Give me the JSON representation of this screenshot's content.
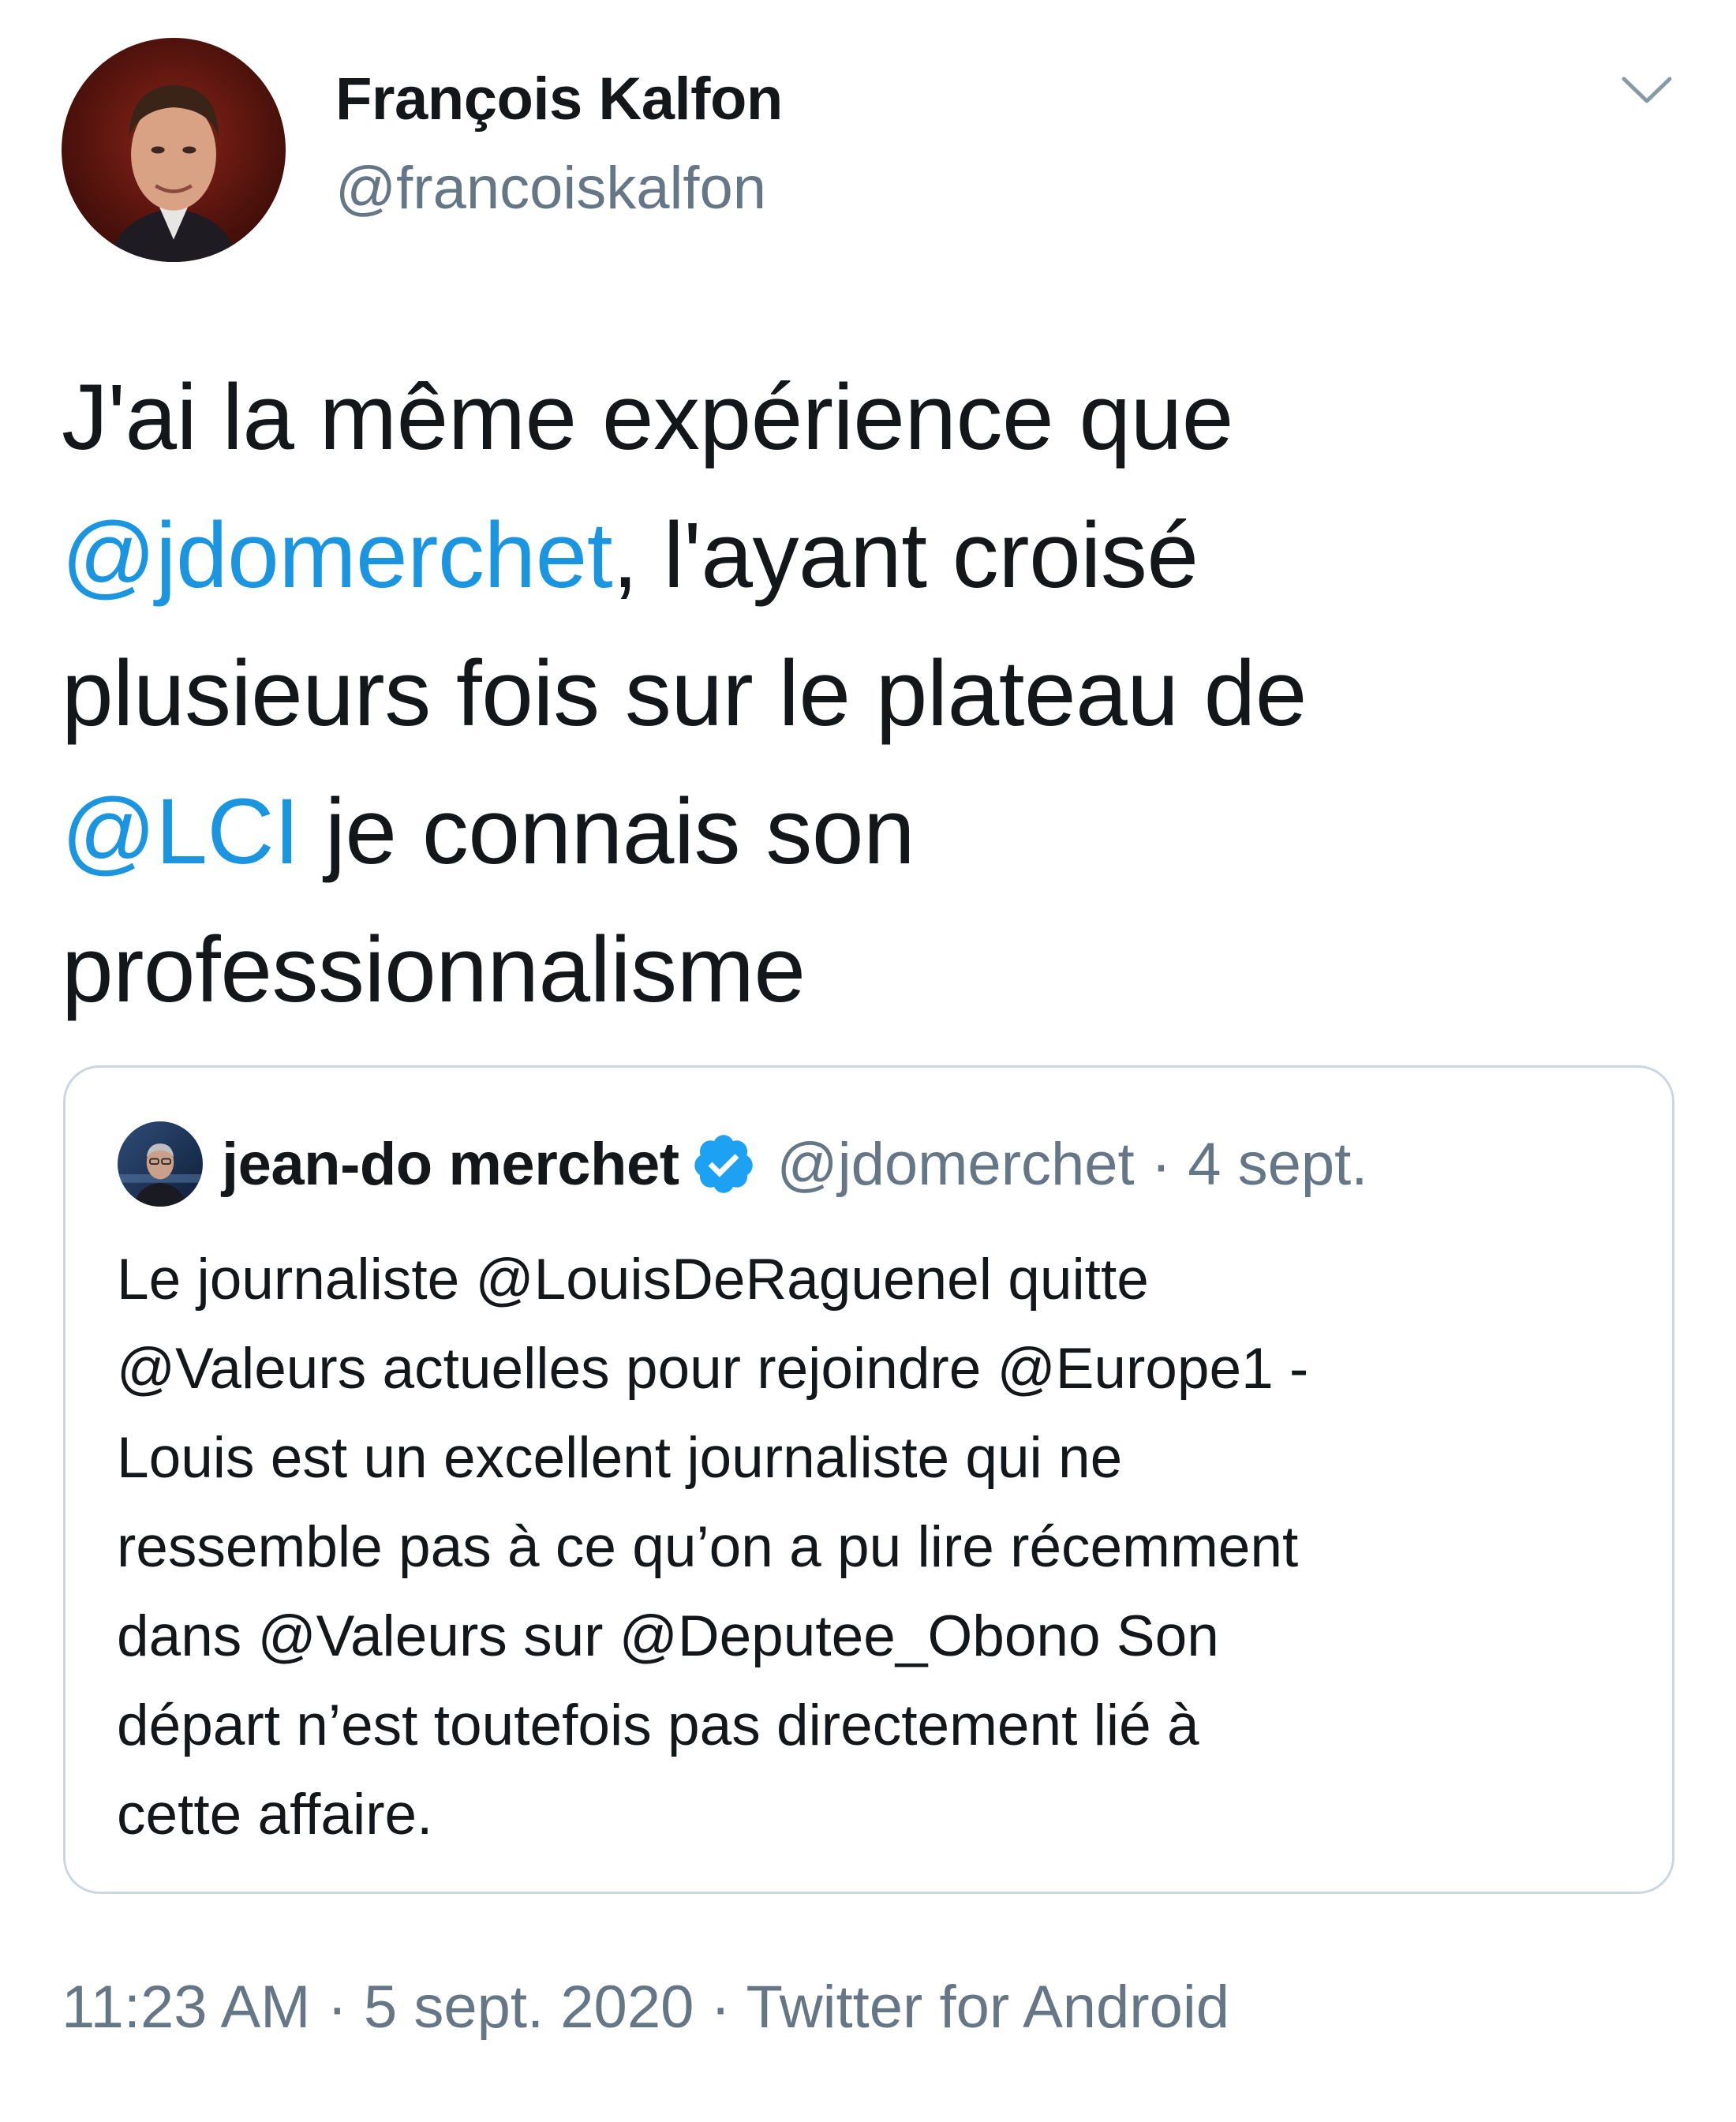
{
  "author": {
    "display_name": "François Kalfon",
    "handle": "@francoiskalfon"
  },
  "tweet": {
    "lines": [
      [
        {
          "text": "J'ai la même expérience que",
          "mention": false
        }
      ],
      [
        {
          "text": "@jdomerchet",
          "mention": true
        },
        {
          "text": ", l'ayant croisé",
          "mention": false
        }
      ],
      [
        {
          "text": "plusieurs fois sur le plateau de",
          "mention": false
        }
      ],
      [
        {
          "text": "@LCI",
          "mention": true
        },
        {
          "text": " je connais son",
          "mention": false
        }
      ],
      [
        {
          "text": "professionnalisme",
          "mention": false
        }
      ]
    ]
  },
  "quoted": {
    "display_name": "jean-do merchet",
    "meta": "@jdomerchet · 4 sept.",
    "lines": [
      "Le journaliste @LouisDeRaguenel quitte",
      "@Valeurs actuelles pour rejoindre @Europe1 -",
      "Louis est un excellent journaliste qui ne",
      "ressemble pas à ce qu’on a pu lire récemment",
      "dans @Valeurs sur @Deputee_Obono Son",
      "départ n’est toutefois pas directement lié à",
      "cette affaire."
    ]
  },
  "footer": {
    "time": "11:23 AM",
    "date": "5 sept. 2020",
    "source": "Twitter for Android",
    "separator": " · "
  },
  "icons": {
    "more": "chevron-down-icon",
    "verified": "verified-badge-icon"
  },
  "colors": {
    "mention": "#1b95e0",
    "secondary_text": "#657786",
    "verified": "#1da1f2",
    "card_border": "#ccd6dd"
  }
}
